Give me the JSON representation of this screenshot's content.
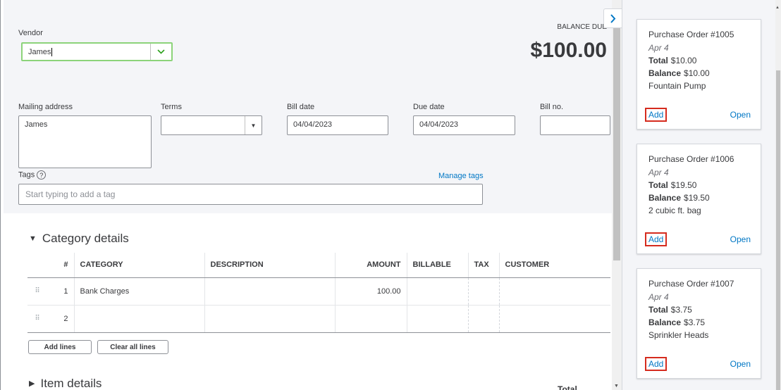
{
  "header": {
    "vendor_label": "Vendor",
    "vendor_value": "James",
    "balance_due_label": "BALANCE DUE",
    "balance_due_amount": "$100.00",
    "mailing_address_label": "Mailing address",
    "mailing_address_value": "James",
    "terms_label": "Terms",
    "terms_value": "",
    "bill_date_label": "Bill date",
    "bill_date_value": "04/04/2023",
    "due_date_label": "Due date",
    "due_date_value": "04/04/2023",
    "bill_no_label": "Bill no.",
    "bill_no_value": "",
    "tags_label": "Tags",
    "manage_tags": "Manage tags",
    "tags_placeholder": "Start typing to add a tag"
  },
  "category": {
    "title": "Category details",
    "columns": [
      "#",
      "CATEGORY",
      "DESCRIPTION",
      "AMOUNT",
      "BILLABLE",
      "TAX",
      "CUSTOMER"
    ],
    "rows": [
      {
        "num": "1",
        "category": "Bank Charges",
        "description": "",
        "amount": "100.00"
      },
      {
        "num": "2",
        "category": "",
        "description": "",
        "amount": ""
      }
    ],
    "add_lines": "Add lines",
    "clear_all_lines": "Clear all lines"
  },
  "item": {
    "title": "Item details",
    "total_label": "Total"
  },
  "drawer": {
    "cards": [
      {
        "title": "Purchase Order #1005",
        "date": "Apr 4",
        "total_label": "Total",
        "total": "$10.00",
        "balance_label": "Balance",
        "balance": "$10.00",
        "desc": "Fountain Pump",
        "add": "Add",
        "open": "Open"
      },
      {
        "title": "Purchase Order #1006",
        "date": "Apr 4",
        "total_label": "Total",
        "total": "$19.50",
        "balance_label": "Balance",
        "balance": "$19.50",
        "desc": "2 cubic ft. bag",
        "add": "Add",
        "open": "Open"
      },
      {
        "title": "Purchase Order #1007",
        "date": "Apr 4",
        "total_label": "Total",
        "total": "$3.75",
        "balance_label": "Balance",
        "balance": "$3.75",
        "desc": "Sprinkler Heads",
        "add": "Add",
        "open": "Open"
      }
    ]
  },
  "icons": {
    "collapse": "chevron-right-icon",
    "vendor_caret": "chevron-down-icon",
    "terms_caret": "caret-down-icon",
    "help": "help-circle-icon",
    "drag": "drag-handle-icon",
    "expanded": "triangle-down-icon",
    "collapsed": "triangle-right-icon"
  },
  "colors": {
    "link": "#0077c5",
    "accent_green": "#2ca01c",
    "highlight_red": "#d52b1e"
  }
}
